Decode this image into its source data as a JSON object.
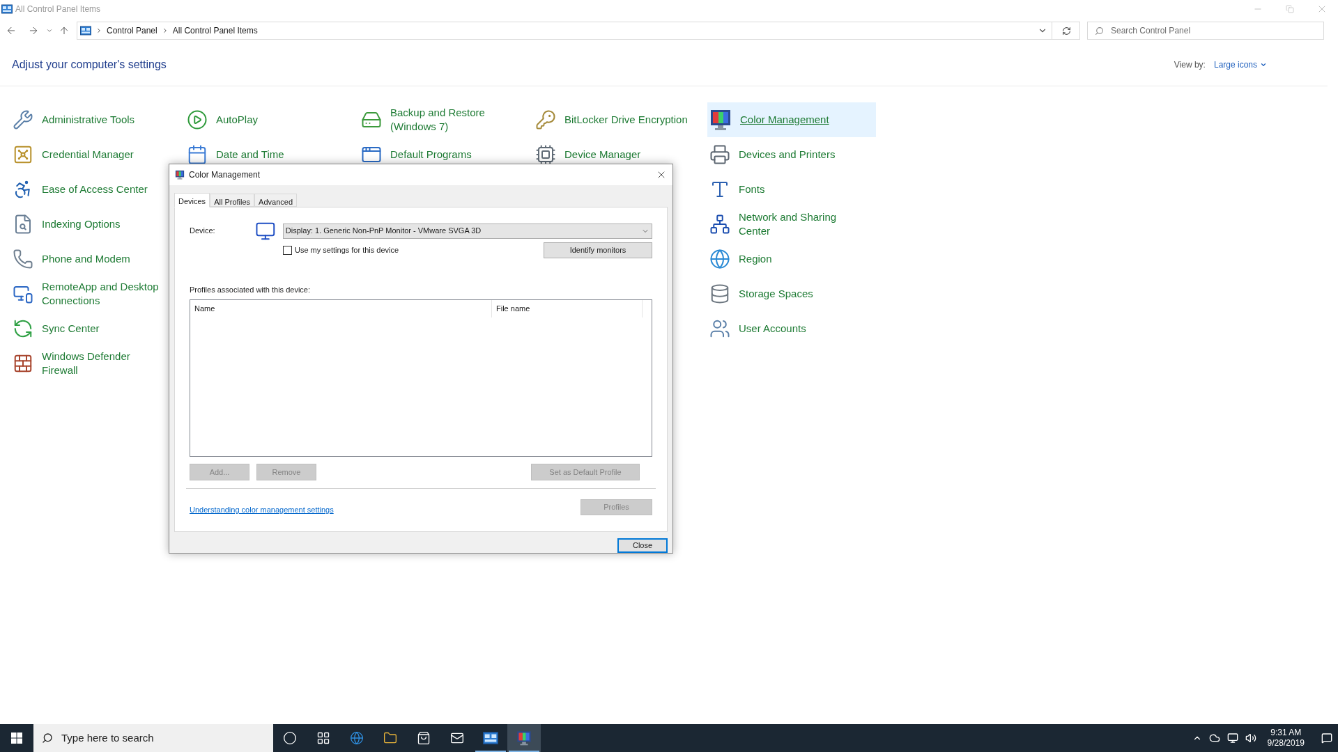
{
  "window": {
    "title": "All Control Panel Items"
  },
  "address_bar": {
    "breadcrumbs": [
      "Control Panel",
      "All Control Panel Items"
    ]
  },
  "search": {
    "placeholder": "Search Control Panel"
  },
  "heading": "Adjust your computer's settings",
  "view_by": {
    "label": "View by:",
    "value": "Large icons"
  },
  "columns": [
    {
      "items": [
        {
          "label": "Administrative Tools",
          "selected": false
        },
        {
          "label": "Credential Manager",
          "selected": false
        },
        {
          "label": "Ease of Access Center",
          "selected": false
        },
        {
          "label": "Indexing Options",
          "selected": false
        },
        {
          "label": "Phone and Modem",
          "selected": false
        },
        {
          "label": "RemoteApp and Desktop Connections",
          "selected": false
        },
        {
          "label": "Sync Center",
          "selected": false
        },
        {
          "label": "Windows Defender Firewall",
          "selected": false
        }
      ]
    },
    {
      "items": [
        {
          "label": "AutoPlay",
          "selected": false
        },
        {
          "label": "Date and Time",
          "selected": false
        }
      ]
    },
    {
      "items": [
        {
          "label": "Backup and Restore (Windows 7)",
          "selected": false
        },
        {
          "label": "Default Programs",
          "selected": false
        }
      ]
    },
    {
      "items": [
        {
          "label": "BitLocker Drive Encryption",
          "selected": false
        },
        {
          "label": "Device Manager",
          "selected": false
        }
      ]
    },
    {
      "items": [
        {
          "label": "Color Management",
          "selected": true
        },
        {
          "label": "Devices and Printers",
          "selected": false
        },
        {
          "label": "Fonts",
          "selected": false
        },
        {
          "label": "Network and Sharing Center",
          "selected": false
        },
        {
          "label": "Region",
          "selected": false
        },
        {
          "label": "Storage Spaces",
          "selected": false
        },
        {
          "label": "User Accounts",
          "selected": false
        }
      ]
    }
  ],
  "dialog": {
    "title": "Color Management",
    "tabs": [
      {
        "label": "Devices",
        "selected": true
      },
      {
        "label": "All Profiles",
        "selected": false
      },
      {
        "label": "Advanced",
        "selected": false
      }
    ],
    "device_label": "Device:",
    "device_value": "Display: 1. Generic Non-PnP Monitor - VMware SVGA 3D",
    "use_my_settings": {
      "label": "Use my settings for this device",
      "checked": false
    },
    "identify_button": "Identify monitors",
    "profiles_label": "Profiles associated with this device:",
    "list_columns": [
      "Name",
      "File name"
    ],
    "buttons": [
      {
        "label": "Add...",
        "disabled": true
      },
      {
        "label": "Remove",
        "disabled": true
      },
      {
        "label": "Set as Default Profile",
        "disabled": true
      }
    ],
    "link": "Understanding color management settings",
    "profiles_button": {
      "label": "Profiles",
      "disabled": true
    },
    "close_button": "Close"
  },
  "taskbar": {
    "search_placeholder": "Type here to search",
    "apps": [
      {
        "running": false,
        "active": false
      },
      {
        "running": false,
        "active": false
      },
      {
        "running": false,
        "active": false
      },
      {
        "running": false,
        "active": false
      },
      {
        "running": false,
        "active": false
      },
      {
        "running": false,
        "active": false
      },
      {
        "running": true,
        "active": false
      },
      {
        "running": true,
        "active": true
      }
    ],
    "time": "9:31 AM",
    "date": "9/28/2019"
  }
}
